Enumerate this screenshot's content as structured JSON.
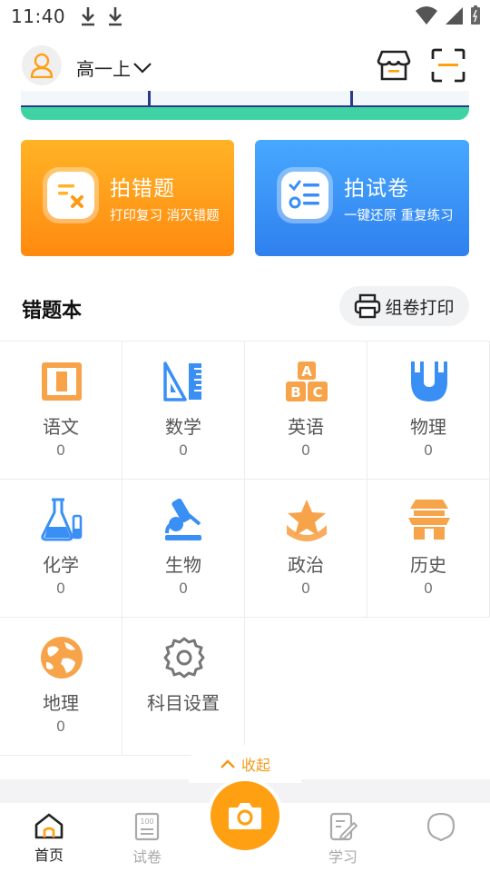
{
  "status": {
    "time": "11:40"
  },
  "header": {
    "grade": "高一上"
  },
  "cards": [
    {
      "title": "拍错题",
      "subtitle": "打印复习 消灭错题"
    },
    {
      "title": "拍试卷",
      "subtitle": "一键还原 重复练习"
    }
  ],
  "section": {
    "title": "错题本",
    "print_label": "组卷打印"
  },
  "subjects": [
    {
      "name": "语文",
      "count": "0",
      "icon": "chinese-book-icon"
    },
    {
      "name": "数学",
      "count": "0",
      "icon": "math-ruler-icon"
    },
    {
      "name": "英语",
      "count": "0",
      "icon": "abc-blocks-icon"
    },
    {
      "name": "物理",
      "count": "0",
      "icon": "magnet-icon"
    },
    {
      "name": "化学",
      "count": "0",
      "icon": "flask-icon"
    },
    {
      "name": "生物",
      "count": "0",
      "icon": "microscope-icon"
    },
    {
      "name": "政治",
      "count": "0",
      "icon": "star-badge-icon"
    },
    {
      "name": "历史",
      "count": "0",
      "icon": "pavilion-icon"
    },
    {
      "name": "地理",
      "count": "0",
      "icon": "globe-icon"
    },
    {
      "name": "科目设置",
      "count": "",
      "icon": "gear-icon"
    }
  ],
  "collapse_label": "收起",
  "nav": [
    {
      "label": "首页",
      "active": true
    },
    {
      "label": "试卷",
      "active": false
    },
    {
      "label": "学习",
      "active": false
    },
    {
      "label": "",
      "active": false
    }
  ],
  "colors": {
    "orange": "#ff9f12",
    "blue": "#3a8ff5",
    "text_gray": "#555555"
  }
}
